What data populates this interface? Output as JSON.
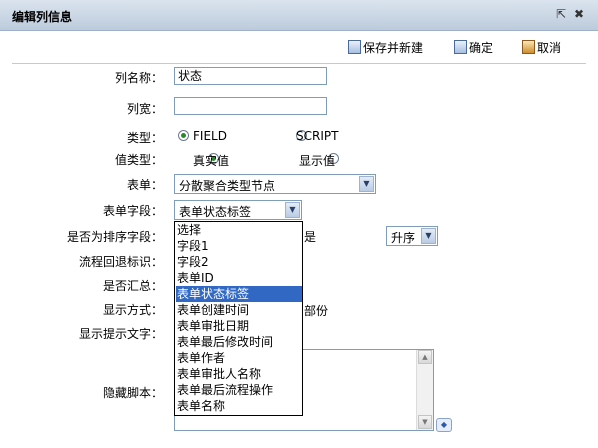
{
  "window": {
    "title": "编辑列信息",
    "actions": [
      {
        "name": "popout-icon",
        "glyph": "⇱"
      },
      {
        "name": "close-icon",
        "glyph": "✖"
      }
    ]
  },
  "toolbar": {
    "save_new_label": "保存并新建",
    "confirm_label": "确定",
    "cancel_label": "取消"
  },
  "form": {
    "column_name": {
      "label": "列名称：",
      "value": "状态"
    },
    "column_width": {
      "label": "列宽：",
      "value": ""
    },
    "type": {
      "label": "类型：",
      "options": [
        "FIELD",
        "SCRIPT"
      ],
      "selected": "FIELD"
    },
    "value_type": {
      "label": "值类型：",
      "options": [
        "真实值",
        "显示值"
      ],
      "selected": "真实值"
    },
    "form_select": {
      "label": "表单：",
      "value": "分散聚合类型节点"
    },
    "form_field": {
      "label": "表单字段：",
      "value": "表单状态标签"
    },
    "sort_field": {
      "label": "是否为排序字段：",
      "hidden_suffix": "是",
      "order_value": "升序"
    },
    "flow_back": {
      "label": "流程回退标识："
    },
    "summary": {
      "label": "是否汇总："
    },
    "display_mode": {
      "label": "显示方式：",
      "partial_text": "部份"
    },
    "display_hint": {
      "label": "显示提示文字："
    },
    "hidden_script": {
      "label": "隐藏脚本：",
      "value": ""
    }
  },
  "form_field_dropdown": {
    "options": [
      "选择",
      "字段1",
      "字段2",
      "表单ID",
      "表单状态标签",
      "表单创建时间",
      "表单审批日期",
      "表单最后修改时间",
      "表单作者",
      "表单审批人名称",
      "表单最后流程操作",
      "表单名称"
    ],
    "selected_index": 4
  },
  "colors": {
    "titlebar_top": "#dbe4ee",
    "titlebar_bottom": "#bccbdc",
    "selection": "#3168c4",
    "input_border": "#7f9db9"
  }
}
